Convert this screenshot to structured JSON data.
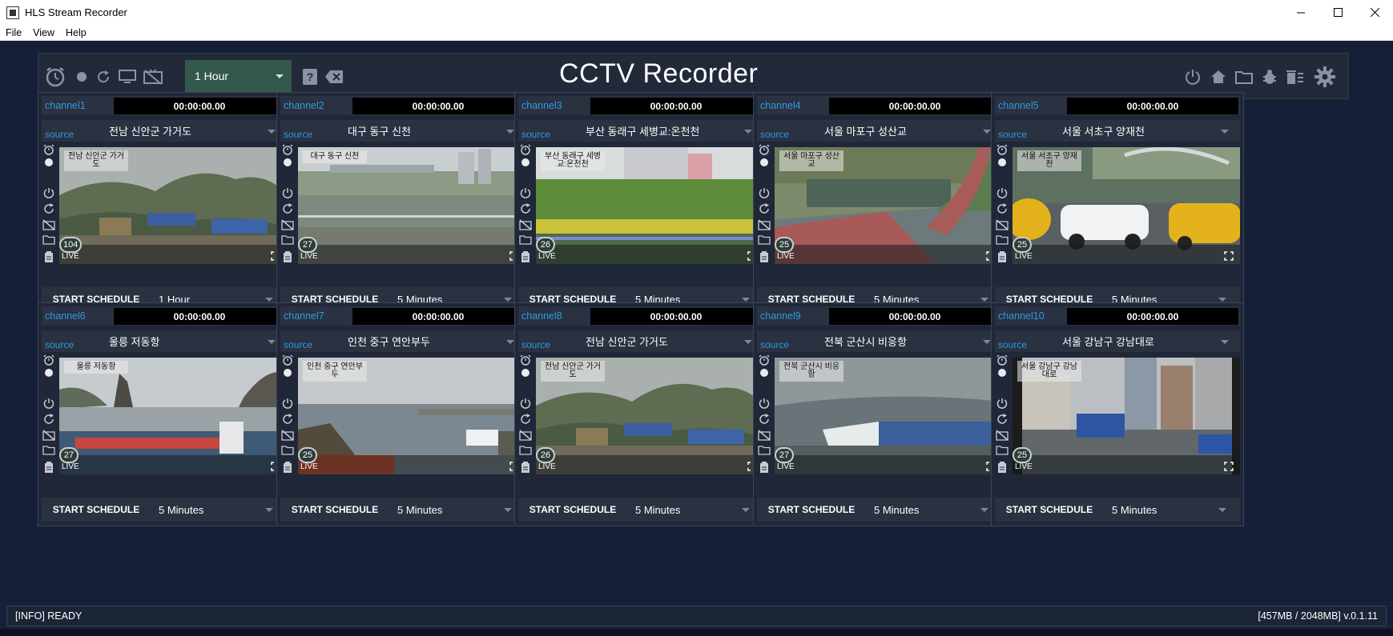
{
  "window": {
    "title": "HLS Stream Recorder"
  },
  "menu": [
    "File",
    "View",
    "Help"
  ],
  "toolbar": {
    "app_title": "CCTV Recorder",
    "duration": "1 Hour",
    "left_icons": [
      "alarm-clock-icon",
      "record-dot-icon",
      "refresh-icon",
      "monitor-icon",
      "no-tv-icon",
      "help-icon",
      "clear-icon"
    ],
    "right_icons": [
      "power-icon",
      "home-icon",
      "folder-icon",
      "bug-icon",
      "trash-list-icon",
      "gear-icon"
    ]
  },
  "channels": [
    {
      "name": "channel1",
      "timer": "00:00:00.00",
      "source_label": "source",
      "source": "전남 신안군 가거도",
      "cam_label": "전남 신안군 가거도",
      "fps": "104",
      "live": "LIVE",
      "schedule_button": "START SCHEDULE",
      "schedule": "1 Hour",
      "scene": "sea-storm"
    },
    {
      "name": "channel2",
      "timer": "00:00:00.00",
      "source_label": "source",
      "source": "대구 동구 신천",
      "cam_label": "대구 동구 신천",
      "fps": "27",
      "live": "LIVE",
      "schedule_button": "START SCHEDULE",
      "schedule": "5 Minutes",
      "scene": "river"
    },
    {
      "name": "channel3",
      "timer": "00:00:00.00",
      "source_label": "source",
      "source": "부산 동래구 세병교:온천천",
      "cam_label": "부산 동래구 세병교:온천천",
      "fps": "26",
      "live": "LIVE",
      "schedule_button": "START SCHEDULE",
      "schedule": "5 Minutes",
      "scene": "park"
    },
    {
      "name": "channel4",
      "timer": "00:00:00.00",
      "source_label": "source",
      "source": "서울 마포구 성산교",
      "cam_label": "서울 마포구 성산교",
      "fps": "25",
      "live": "LIVE",
      "schedule_button": "START SCHEDULE",
      "schedule": "5 Minutes",
      "scene": "path"
    },
    {
      "name": "channel5",
      "timer": "00:00:00.00",
      "source_label": "source",
      "source": "서울 서초구 양재천",
      "cam_label": "서울 서초구 양재천",
      "fps": "25",
      "live": "LIVE",
      "schedule_button": "START SCHEDULE",
      "schedule": "5 Minutes",
      "scene": "traffic"
    },
    {
      "name": "channel6",
      "timer": "00:00:00.00",
      "source_label": "source",
      "source": "울릉 저동항",
      "cam_label": "울릉 저동항",
      "fps": "27",
      "live": "LIVE",
      "schedule_button": "START SCHEDULE",
      "schedule": "5 Minutes",
      "scene": "harbor-rock"
    },
    {
      "name": "channel7",
      "timer": "00:00:00.00",
      "source_label": "source",
      "source": "인천 중구 연안부두",
      "cam_label": "인천 중구 연안부두",
      "fps": "25",
      "live": "LIVE",
      "schedule_button": "START SCHEDULE",
      "schedule": "5 Minutes",
      "scene": "pier"
    },
    {
      "name": "channel8",
      "timer": "00:00:00.00",
      "source_label": "source",
      "source": "전남 신안군 가거도",
      "cam_label": "전남 신안군 가거도",
      "fps": "26",
      "live": "LIVE",
      "schedule_button": "START SCHEDULE",
      "schedule": "5 Minutes",
      "scene": "sea-storm"
    },
    {
      "name": "channel9",
      "timer": "00:00:00.00",
      "source_label": "source",
      "source": "전북 군산시 비응항",
      "cam_label": "전북 군산시 비응항",
      "fps": "27",
      "live": "LIVE",
      "schedule_button": "START SCHEDULE",
      "schedule": "5 Minutes",
      "scene": "boats-rain"
    },
    {
      "name": "channel10",
      "timer": "00:00:00.00",
      "source_label": "source",
      "source": "서울 강남구 강남대로",
      "cam_label": "서울 강남구 강남대로",
      "fps": "25",
      "live": "LIVE",
      "schedule_button": "START SCHEDULE",
      "schedule": "5 Minutes",
      "scene": "city"
    }
  ],
  "status": {
    "left": "[INFO] READY",
    "right": "[457MB / 2048MB] v.0.1.11"
  },
  "colors": {
    "accent_blue": "#2f9ae0",
    "panel": "#1f2738",
    "background": "#152038",
    "duration_green": "#34584c"
  }
}
